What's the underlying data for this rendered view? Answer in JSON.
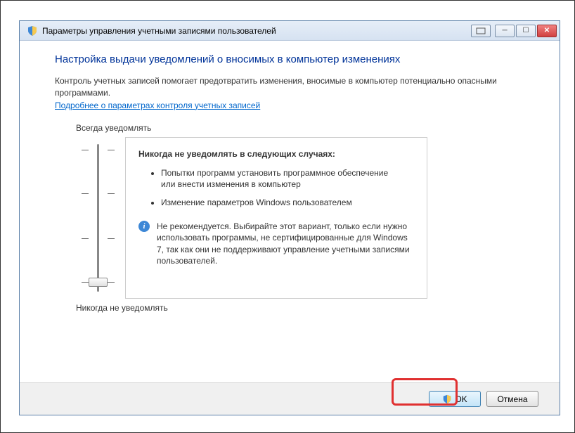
{
  "window": {
    "title": "Параметры управления учетными записями пользователей"
  },
  "content": {
    "heading": "Настройка выдачи уведомлений о вносимых в компьютер изменениях",
    "intro": "Контроль учетных записей помогает предотвратить изменения, вносимые в компьютер потенциально опасными программами.",
    "link": "Подробнее о параметрах контроля учетных записей",
    "slider": {
      "topLabel": "Всегда уведомлять",
      "bottomLabel": "Никогда не уведомлять"
    },
    "panel": {
      "title": "Никогда не уведомлять в следующих случаях:",
      "item1": "Попытки программ установить программное обеспечение или внести изменения в компьютер",
      "item2": "Изменение параметров Windows пользователем",
      "warning": "Не рекомендуется. Выбирайте этот вариант, только если нужно использовать программы, не сертифицированные для Windows 7, так как они не поддерживают управление учетными записями пользователей."
    }
  },
  "buttons": {
    "ok": "OK",
    "cancel": "Отмена"
  }
}
